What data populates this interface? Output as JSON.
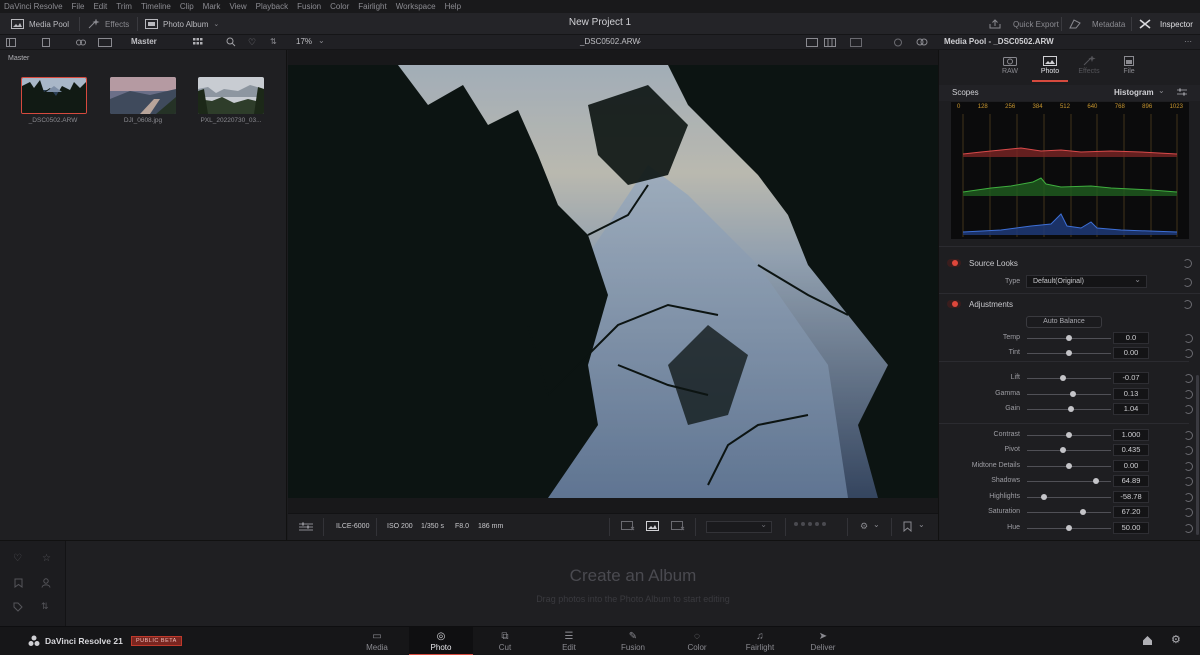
{
  "menu": [
    "DaVinci Resolve",
    "File",
    "Edit",
    "Trim",
    "Timeline",
    "Clip",
    "Mark",
    "View",
    "Playback",
    "Fusion",
    "Color",
    "Fairlight",
    "Workspace",
    "Help"
  ],
  "toolbar": {
    "media_pool": "Media Pool",
    "effects": "Effects",
    "photo_album": "Photo Album",
    "project_title": "New Project 1",
    "quick_export": "Quick Export",
    "metadata": "Metadata",
    "inspector": "Inspector"
  },
  "subbar": {
    "bin": "Master",
    "zoom": "17%",
    "clip_name": "_DSC0502.ARW",
    "inspector_title": "Media Pool - _DSC0502.ARW"
  },
  "media_pool": {
    "folder": "Master",
    "items": [
      {
        "name": "_DSC0502.ARW",
        "selected": true
      },
      {
        "name": "DJI_0608.jpg",
        "selected": false
      },
      {
        "name": "PXL_20220730_03...",
        "selected": false
      }
    ]
  },
  "viewer_footer": {
    "camera": "ILCE-6000",
    "iso": "ISO 200",
    "shutter": "1/350 s",
    "aperture": "F8.0",
    "focal": "186 mm",
    "rating_stars": 0
  },
  "inspector": {
    "tabs": [
      {
        "label": "RAW",
        "icon": "raw-icon",
        "active": false
      },
      {
        "label": "Photo",
        "icon": "photo-icon",
        "active": true
      },
      {
        "label": "Effects",
        "icon": "effects-icon",
        "active": false
      },
      {
        "label": "File",
        "icon": "file-icon",
        "active": false
      }
    ],
    "scopes": {
      "label": "Scopes",
      "mode": "Histogram",
      "ticks": [
        "0",
        "128",
        "256",
        "384",
        "512",
        "640",
        "768",
        "896",
        "1023"
      ]
    },
    "source_looks": {
      "label": "Source Looks",
      "type_label": "Type",
      "type_value": "Default(Original)"
    },
    "adjustments": {
      "label": "Adjustments",
      "auto_balance": "Auto Balance",
      "params": [
        {
          "label": "Temp",
          "value": "0.0",
          "pos": 0.5
        },
        {
          "label": "Tint",
          "value": "0.00",
          "pos": 0.5
        },
        {
          "label": "Lift",
          "value": "-0.07",
          "pos": 0.43
        },
        {
          "label": "Gamma",
          "value": "0.13",
          "pos": 0.55
        },
        {
          "label": "Gain",
          "value": "1.04",
          "pos": 0.52
        },
        {
          "label": "Contrast",
          "value": "1.000",
          "pos": 0.5
        },
        {
          "label": "Pivot",
          "value": "0.435",
          "pos": 0.43
        },
        {
          "label": "Midtone Details",
          "value": "0.00",
          "pos": 0.5
        },
        {
          "label": "Shadows",
          "value": "64.89",
          "pos": 0.82
        },
        {
          "label": "Highlights",
          "value": "-58.78",
          "pos": 0.2
        },
        {
          "label": "Saturation",
          "value": "67.20",
          "pos": 0.67
        },
        {
          "label": "Hue",
          "value": "50.00",
          "pos": 0.5
        }
      ]
    }
  },
  "album": {
    "title": "Create an Album",
    "subtitle": "Drag photos into the Photo Album to start editing"
  },
  "brand": {
    "name": "DaVinci Resolve 21",
    "badge": "PUBLIC BETA",
    "badge_color": "#c0392b"
  },
  "pages": [
    {
      "label": "Media",
      "icon": "media-page-icon",
      "active": false
    },
    {
      "label": "Photo",
      "icon": "photo-page-icon",
      "active": true
    },
    {
      "label": "Cut",
      "icon": "cut-page-icon",
      "active": false
    },
    {
      "label": "Edit",
      "icon": "edit-page-icon",
      "active": false
    },
    {
      "label": "Fusion",
      "icon": "fusion-page-icon",
      "active": false
    },
    {
      "label": "Color",
      "icon": "color-page-icon",
      "active": false
    },
    {
      "label": "Fairlight",
      "icon": "fairlight-page-icon",
      "active": false
    },
    {
      "label": "Deliver",
      "icon": "deliver-page-icon",
      "active": false
    }
  ],
  "colors": {
    "accent": "#d64a3e",
    "histogram_red": "#d84a4a",
    "histogram_green": "#3fae3f",
    "histogram_blue": "#3d6fd6"
  }
}
